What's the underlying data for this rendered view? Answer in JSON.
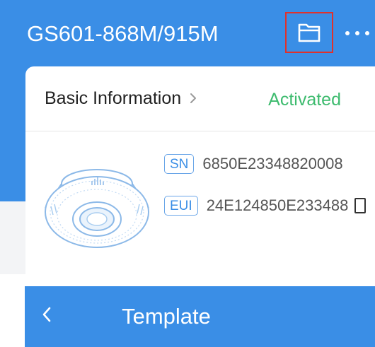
{
  "header": {
    "title": "GS601-868M/915M",
    "folder_icon": "folder-icon",
    "more_icon": "more-horizontal-icon"
  },
  "card": {
    "basic_info_label": "Basic Information",
    "chevron_icon": "chevron-right-icon",
    "status": "Activated",
    "sn_badge": "SN",
    "sn_value": "6850E23348820008",
    "eui_badge": "EUI",
    "eui_value": "24E124850E233488",
    "copy_icon": "copy-icon"
  },
  "nav": {
    "back_icon": "chevron-left-icon",
    "title": "Template"
  },
  "colors": {
    "primary": "#3a8ee6",
    "status_green": "#3dbb6e",
    "highlight_red": "#e0312b"
  }
}
